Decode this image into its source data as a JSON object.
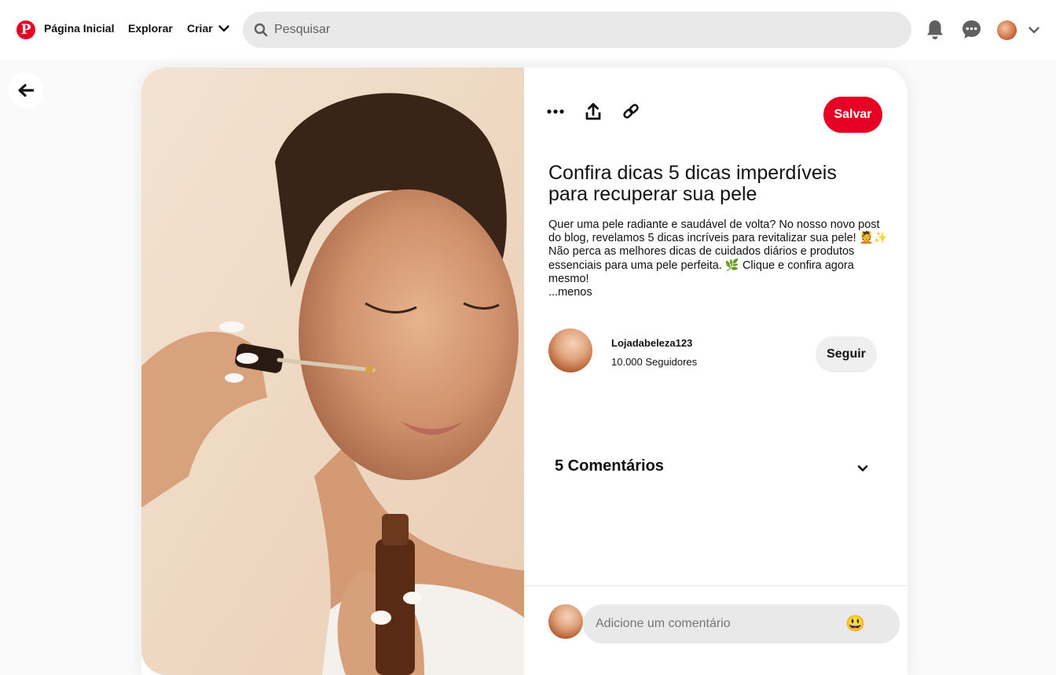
{
  "nav": {
    "logo": "P",
    "home": "Página Inicial",
    "explore": "Explorar",
    "create": "Criar",
    "search_placeholder": "Pesquisar",
    "icons": [
      "pinterest-logo-icon",
      "search-icon",
      "bell-icon",
      "chat-icon",
      "chevron-down-icon"
    ]
  },
  "pin": {
    "save_label": "Salvar",
    "title": "Confira dicas 5 dicas imperdíveis para recuperar sua pele",
    "description": "Quer uma pele radiante e saudável de volta? No nosso novo post do blog, revelamos 5 dicas incríveis para revitalizar sua pele! 💆✨ Não perca as melhores dicas de cuidados diários e produtos essenciais para uma pele perfeita. 🌿 Clique e confira agora mesmo!",
    "less_label": "...menos",
    "action_icons": [
      "more-icon",
      "share-icon",
      "link-icon"
    ]
  },
  "creator": {
    "name": "Lojadabeleza123",
    "followers": "10.000 Seguidores",
    "follow_label": "Seguir"
  },
  "comments": {
    "title": "5 Comentários",
    "input_placeholder": "Adicione um comentário",
    "emoji": "😃"
  },
  "colors": {
    "brand": "#e60023",
    "search_bg": "#e9e9e9",
    "follow_bg": "#efefef"
  }
}
